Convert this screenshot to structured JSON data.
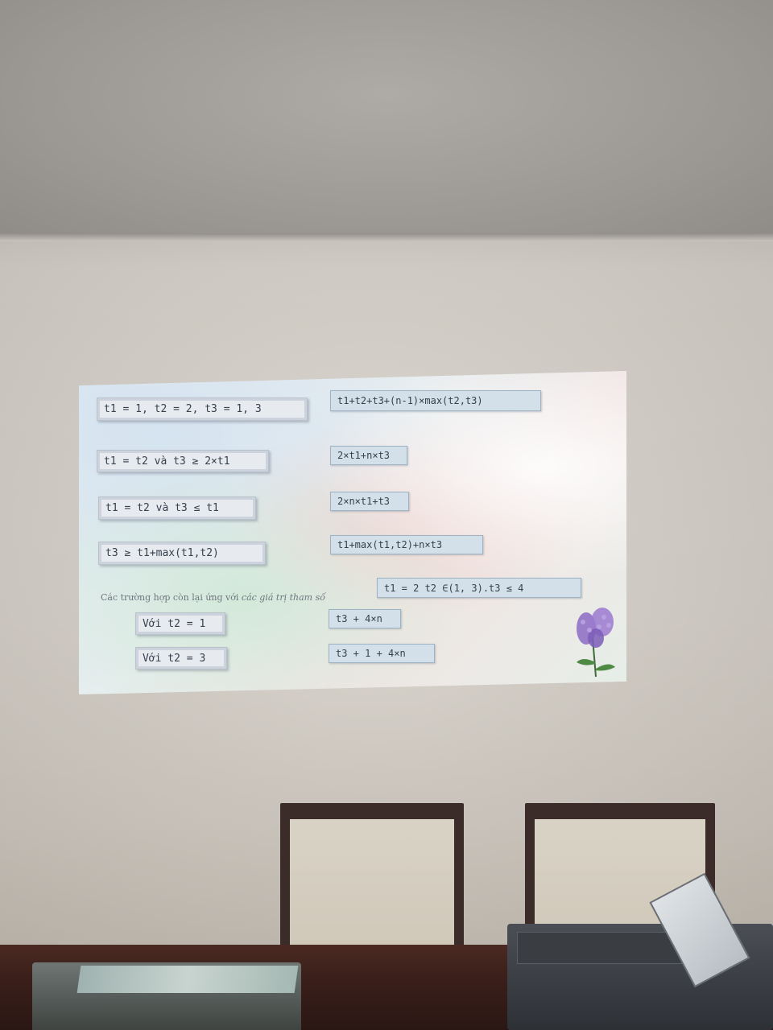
{
  "slide": {
    "left_boxes": [
      {
        "text": "t1 = 1, t2 = 2, t3 = 1, 3"
      },
      {
        "text": "t1 = t2 và t3 ≥ 2×t1"
      },
      {
        "text": "t1 = t2 và t3 ≤ t1"
      },
      {
        "text": "t3 ≥ t1+max(t1,t2)"
      }
    ],
    "right_boxes": [
      {
        "text": "t1+t2+t3+(n-1)×max(t2,t3)"
      },
      {
        "text": "2×t1+n×t3"
      },
      {
        "text": "2×n×t1+t3"
      },
      {
        "text": "t1+max(t1,t2)+n×t3"
      }
    ],
    "prose": {
      "prefix": "Các trường hợp còn lại ứng với ",
      "italic": "các giá trị tham số"
    },
    "param_box": "t1 = 2 t2 ∈(1, 3).t3 ≤ 4",
    "sub_left": [
      {
        "text": "Với t2 = 1"
      },
      {
        "text": "Với t2 = 3"
      }
    ],
    "sub_right": [
      {
        "text": "t3 + 4×n"
      },
      {
        "text": "t3 + 1 + 4×n"
      }
    ],
    "colors": {
      "box_fill": "#d3e0ea",
      "box_text": "#37404d",
      "flower": "#8c6bc4"
    },
    "decoration_icon": "lilac-flower-icon"
  }
}
